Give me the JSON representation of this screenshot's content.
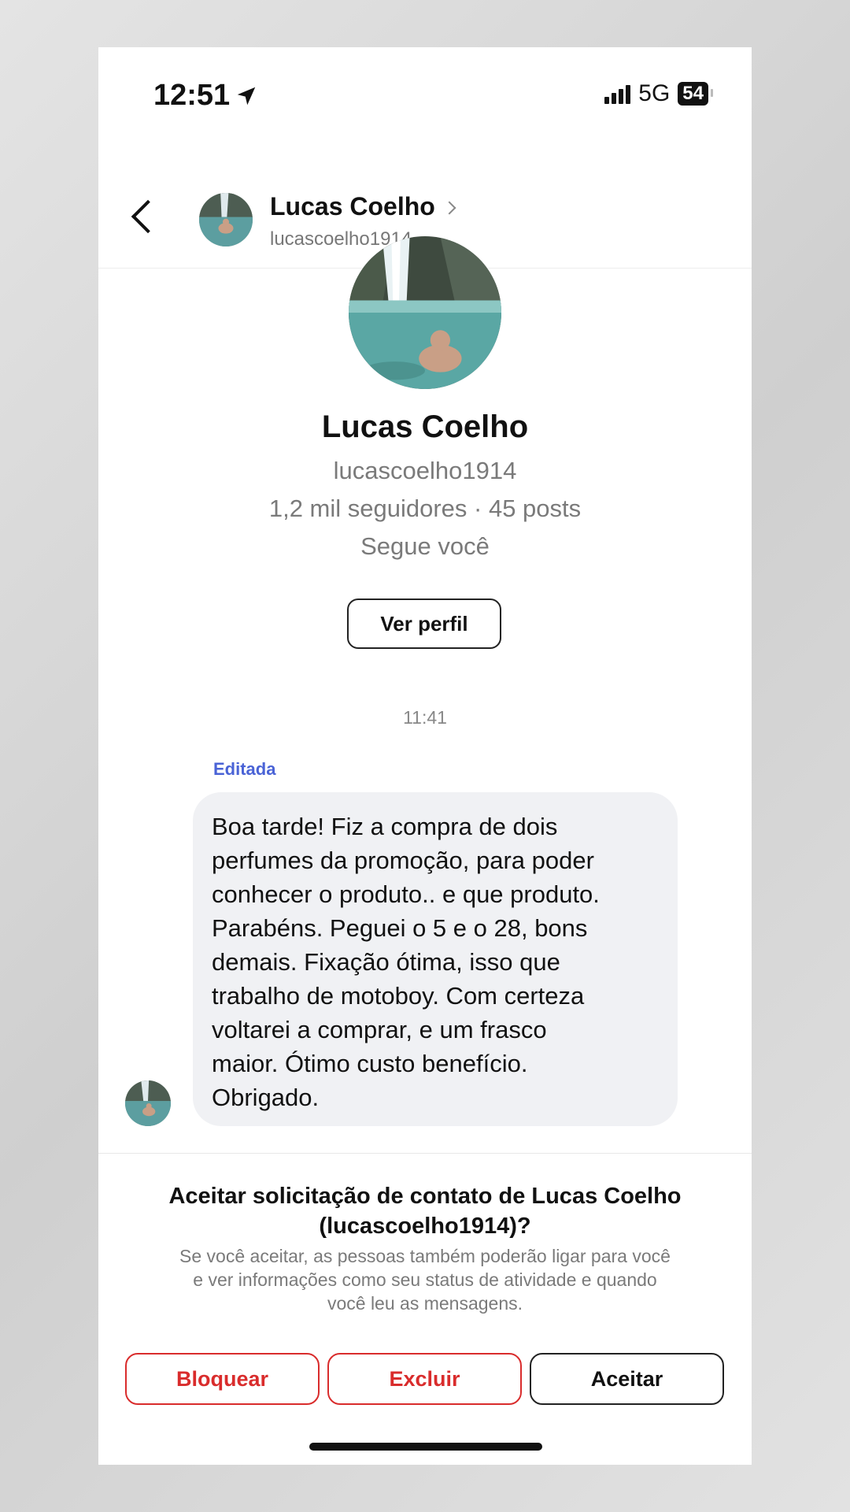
{
  "status_bar": {
    "time": "12:51",
    "network": "5G",
    "battery": "54"
  },
  "header": {
    "name": "Lucas Coelho",
    "username": "lucascoelho1914"
  },
  "profile": {
    "name": "Lucas Coelho",
    "username": "lucascoelho1914",
    "stats": "1,2 mil seguidores · 45 posts",
    "follow_status": "Segue você",
    "view_profile_label": "Ver perfil"
  },
  "conversation": {
    "timestamp": "11:41",
    "edited_label": "Editada",
    "message": "Boa tarde! Fiz a compra de dois\nperfumes da promoção, para poder\nconhecer o produto.. e que produto.\nParabéns. Peguei o 5 e o 28, bons\ndemais. Fixação ótima, isso que\ntrabalho de motoboy. Com certeza\nvoltarei a comprar, e um frasco\nmaior. Ótimo custo benefício.\nObrigado."
  },
  "request": {
    "title": "Aceitar solicitação de contato de Lucas Coelho\n(lucascoelho1914)?",
    "description": "Se você aceitar, as pessoas também poderão ligar para você\ne ver informações como seu status de atividade e quando\nvocê leu as mensagens.",
    "block_label": "Bloquear",
    "delete_label": "Excluir",
    "accept_label": "Aceitar"
  },
  "colors": {
    "destructive": "#d92c2c",
    "edited_accent": "#4a63d6",
    "bubble_bg": "#f0f1f4"
  },
  "icons": [
    "location-arrow-icon",
    "signal-bars-icon",
    "battery-icon",
    "back-chevron-icon",
    "chevron-right-icon"
  ]
}
